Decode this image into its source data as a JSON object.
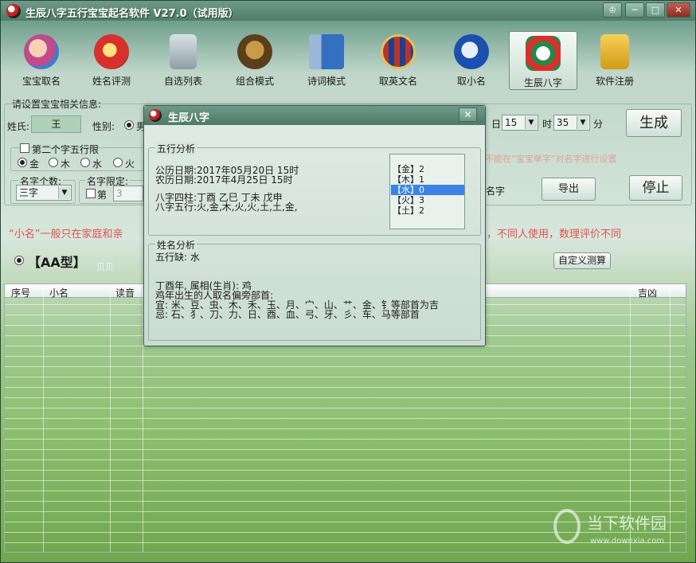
{
  "window": {
    "title": "生辰八字五行宝宝起名软件 V27.0（试用版）",
    "buttons": {
      "skin": "♔",
      "minimize": "─",
      "maximize": "□",
      "close": "✕"
    }
  },
  "toolbar": {
    "items": [
      {
        "label": "宝宝取名",
        "icon": "baby-icon",
        "color": "#c04a8a"
      },
      {
        "label": "姓名评测",
        "icon": "lantern-icon",
        "color": "#d8312b"
      },
      {
        "label": "自选列表",
        "icon": "pen-holder-icon",
        "color": "#b7c4c9"
      },
      {
        "label": "组合模式",
        "icon": "lion-icon",
        "color": "#7a5b2c"
      },
      {
        "label": "诗词模式",
        "icon": "book-icon",
        "color": "#3470c0"
      },
      {
        "label": "取英文名",
        "icon": "crest-icon",
        "color": "#b8342b"
      },
      {
        "label": "取小名",
        "icon": "eagle-icon",
        "color": "#1b4fb0"
      },
      {
        "label": "生辰八字",
        "icon": "bagua-icon",
        "color": "#1f8a4a"
      },
      {
        "label": "软件注册",
        "icon": "lock-icon",
        "color": "#e0a925"
      }
    ]
  },
  "settings": {
    "title": "请设置宝宝相关信息:",
    "surname_label": "姓氏:",
    "surname_value": "王",
    "gender_label": "性别:",
    "gender_value": "男",
    "day_value": "15",
    "day_unit": "日",
    "hour_value": "15",
    "hour_unit": "时",
    "minute_value": "35",
    "minute_unit": "分",
    "second_char_label": "第二个字五行限",
    "elements": [
      "金",
      "木",
      "水",
      "火"
    ],
    "name_count_label": "名字个数:",
    "name_count_value": "三字",
    "name_limit_label": "名字限定:",
    "name_limit_check": "第",
    "name_limit_value": "3",
    "name_suffix": "名字",
    "faded_hint": "不能在“宝宝单字”对名字进行设置",
    "generate_button": "生成",
    "export_button": "导出",
    "stop_button": "停止"
  },
  "notice": {
    "left": "“小名”一般只在家庭和亲",
    "right": "，不同人使用，数理评价不同"
  },
  "results": {
    "type_label": "【AA型】",
    "type_sub": "贝贝",
    "custom_button": "自定义测算",
    "columns": [
      "序号",
      "小名",
      "读音",
      "吉凶"
    ]
  },
  "watermark": {
    "main": "当下软件园",
    "sub": "www.downxia.com"
  },
  "dialog": {
    "title": "生辰八字",
    "close": "✕",
    "wuxing_group": "五行分析",
    "solar_date": "公历日期:2017年05月20日 15时",
    "lunar_date": "农历日期:2017年4月25日 15时",
    "bazi_pillars": "八字四柱:丁酉 乙巳 丁未 戊申",
    "bazi_elements": "八字五行:火,金,木,火,火,土,土,金,",
    "element_counts": [
      {
        "text": "【金】2",
        "selected": false
      },
      {
        "text": "【木】1",
        "selected": false
      },
      {
        "text": "【水】0",
        "selected": true
      },
      {
        "text": "【火】3",
        "selected": false
      },
      {
        "text": "【土】2",
        "selected": false
      }
    ],
    "name_group": "姓名分析",
    "missing_element": "五行缺: 水",
    "zodiac_line": "丁酉年, 属相(生肖): 鸡",
    "radicals_intro": "鸡年出生的人取名偏旁部首:",
    "radicals_good": "宜: 米、豆、虫、木、禾、玉、月、宀、山、艹、金、钅等部首为吉",
    "radicals_bad": "忌: 石、犭、刀、力、日、酉、血、弓、牙、彡、车、马等部首"
  }
}
